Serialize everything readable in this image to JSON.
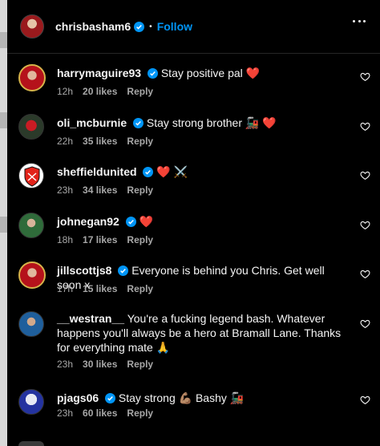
{
  "header": {
    "username": "chrisbasham6",
    "separator": "•",
    "follow_label": "Follow",
    "more_icon": "more-horizontal-icon"
  },
  "colors": {
    "follow_blue": "#0095f6",
    "verified_blue": "#0095f6",
    "meta_grey": "#a8a8a8",
    "heart_red": "#ff3040"
  },
  "comments": [
    {
      "username": "harrymaguire93",
      "text": "Stay positive pal ❤️",
      "time": "12h",
      "likes": "20 likes",
      "reply": "Reply"
    },
    {
      "username": "oli_mcburnie",
      "text": "Stay strong brother 🚂 ❤️",
      "time": "22h",
      "likes": "35 likes",
      "reply": "Reply"
    },
    {
      "username": "sheffieldunited",
      "text": "❤️ ⚔️",
      "time": "23h",
      "likes": "34 likes",
      "reply": "Reply"
    },
    {
      "username": "johnegan92",
      "text": "❤️",
      "time": "18h",
      "likes": "17 likes",
      "reply": "Reply"
    },
    {
      "username": "jillscottjs8",
      "text": "Everyone is behind you Chris. Get well soon x",
      "time": "17h",
      "likes": "15 likes",
      "reply": "Reply"
    },
    {
      "username": "__westran__",
      "text": "You're a fucking legend bash. Whatever happens you'll always be a hero at Bramall Lane. Thanks for everything mate 🙏",
      "time": "23h",
      "likes": "30 likes",
      "reply": "Reply"
    },
    {
      "username": "pjags06",
      "text": "Stay strong 💪🏽  Bashy 🚂",
      "time": "23h",
      "likes": "60 likes",
      "reply": "Reply"
    }
  ]
}
